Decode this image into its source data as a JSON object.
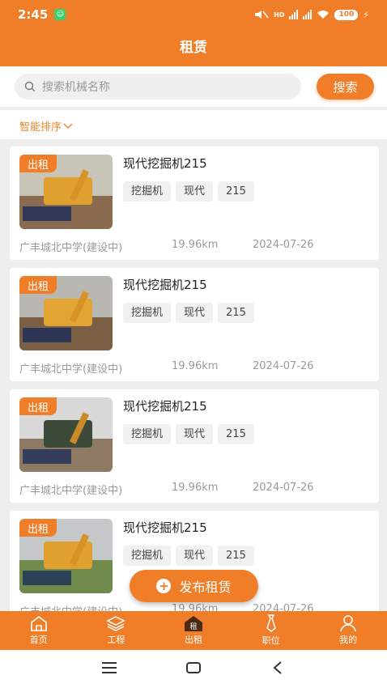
{
  "status_bar": {
    "time": "2:45",
    "network": "HD",
    "battery": "100"
  },
  "header": {
    "title": "租赁"
  },
  "search": {
    "placeholder": "搜索机械名称",
    "button_label": "搜索"
  },
  "sort": {
    "label": "智能排序"
  },
  "listings": [
    {
      "badge": "出租",
      "title": "现代挖掘机215",
      "tags": [
        "挖掘机",
        "现代",
        "215"
      ],
      "location": "广丰城北中学(建设中)",
      "distance": "19.96km",
      "date": "2024-07-26"
    },
    {
      "badge": "出租",
      "title": "现代挖掘机215",
      "tags": [
        "挖掘机",
        "现代",
        "215"
      ],
      "location": "广丰城北中学(建设中)",
      "distance": "19.96km",
      "date": "2024-07-26"
    },
    {
      "badge": "出租",
      "title": "现代挖掘机215",
      "tags": [
        "挖掘机",
        "现代",
        "215"
      ],
      "location": "广丰城北中学(建设中)",
      "distance": "19.96km",
      "date": "2024-07-26"
    },
    {
      "badge": "出租",
      "title": "现代挖掘机215",
      "tags": [
        "挖掘机",
        "现代",
        "215"
      ],
      "location": "广丰城北中学(建设中)",
      "distance": "19.96km",
      "date": "2024-07-26"
    }
  ],
  "fab": {
    "label": "发布租赁"
  },
  "tabbar": {
    "items": [
      {
        "label": "首页",
        "icon": "home-icon"
      },
      {
        "label": "工程",
        "icon": "layers-icon"
      },
      {
        "label": "出租",
        "icon": "rent-house-icon",
        "active": true
      },
      {
        "label": "职位",
        "icon": "tie-icon"
      },
      {
        "label": "我的",
        "icon": "person-icon"
      }
    ]
  },
  "colors": {
    "accent": "#f07d27",
    "background": "#eeeeee"
  }
}
